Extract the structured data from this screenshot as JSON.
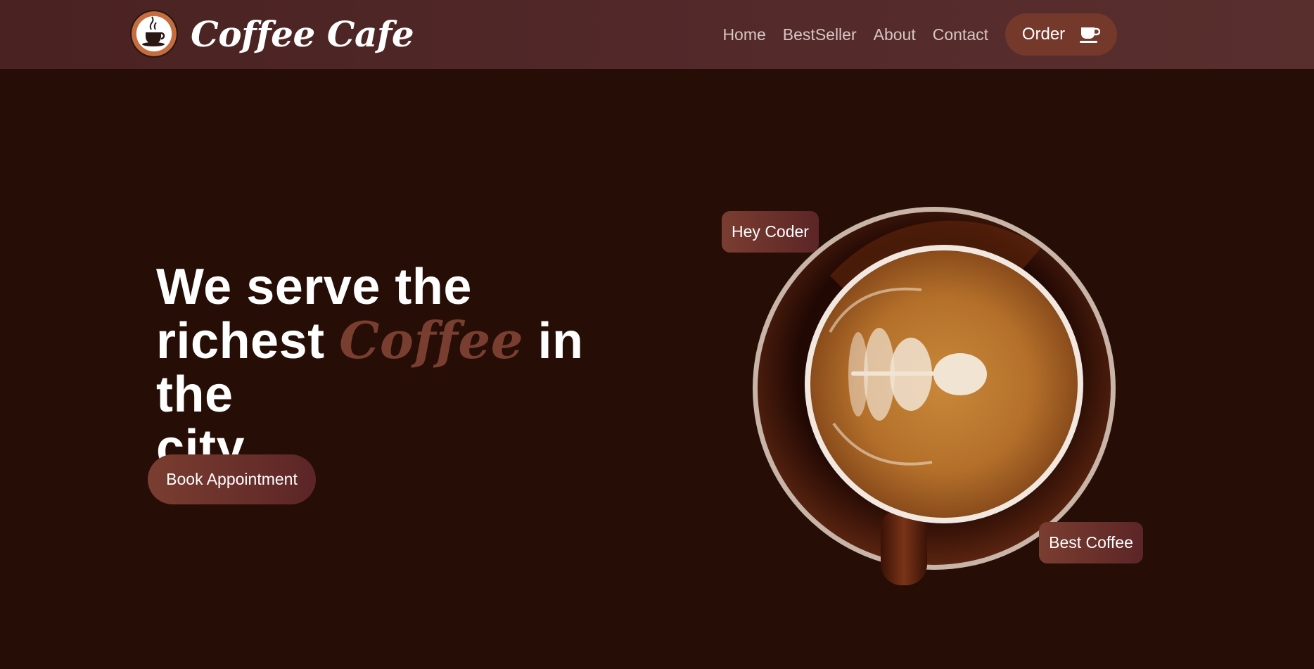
{
  "nav": {
    "brand": "Coffee Cafe",
    "links": [
      "Home",
      "BestSeller",
      "About",
      "Contact"
    ],
    "order_label": "Order"
  },
  "hero": {
    "line1": "We serve the",
    "line2_before": "richest ",
    "accent": "Coffee",
    "line2_after": " in the",
    "line3": "city",
    "cta": "Book Appointment"
  },
  "badges": {
    "top": "Hey Coder",
    "bottom": "Best Coffee"
  },
  "icons": {
    "logo": "coffee-cup-logo-icon",
    "order": "coffee-cup-icon"
  },
  "colors": {
    "background": "#260e07",
    "navbar": "#53292a",
    "accent": "#7a3e31",
    "button": "#75392c"
  }
}
